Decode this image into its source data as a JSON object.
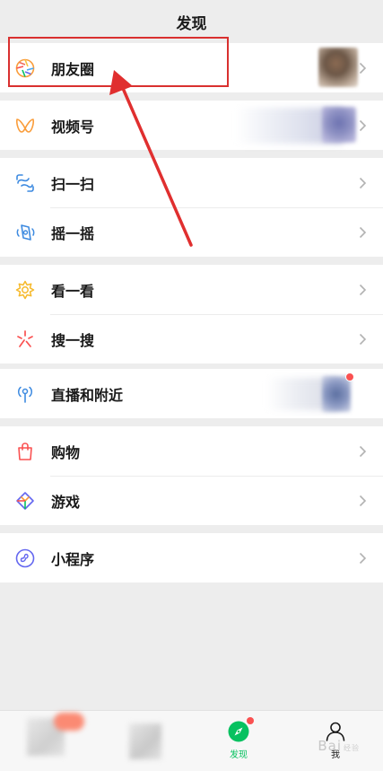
{
  "header": {
    "title": "发现"
  },
  "sections": [
    {
      "items": [
        {
          "label": "朋友圈",
          "icon": "moments-icon"
        }
      ]
    },
    {
      "items": [
        {
          "label": "视频号",
          "icon": "channels-icon"
        }
      ]
    },
    {
      "items": [
        {
          "label": "扫一扫",
          "icon": "scan-icon"
        },
        {
          "label": "摇一摇",
          "icon": "shake-icon"
        }
      ]
    },
    {
      "items": [
        {
          "label": "看一看",
          "icon": "top-stories-icon"
        },
        {
          "label": "搜一搜",
          "icon": "search-icon"
        }
      ]
    },
    {
      "items": [
        {
          "label": "直播和附近",
          "icon": "live-nearby-icon"
        }
      ]
    },
    {
      "items": [
        {
          "label": "购物",
          "icon": "shopping-icon"
        },
        {
          "label": "游戏",
          "icon": "games-icon"
        }
      ]
    },
    {
      "items": [
        {
          "label": "小程序",
          "icon": "mini-programs-icon"
        }
      ]
    }
  ],
  "tabbar": {
    "tabs": [
      {
        "label": "",
        "active": false
      },
      {
        "label": "",
        "active": false
      },
      {
        "label": "发现",
        "active": true,
        "icon": "discover-icon",
        "color": "#07c160"
      },
      {
        "label": "我",
        "active": false,
        "icon": "me-icon"
      }
    ]
  },
  "annotation": {
    "color": "#d9302f"
  },
  "watermark": {
    "text": "Bai",
    "suffix": "经验"
  }
}
